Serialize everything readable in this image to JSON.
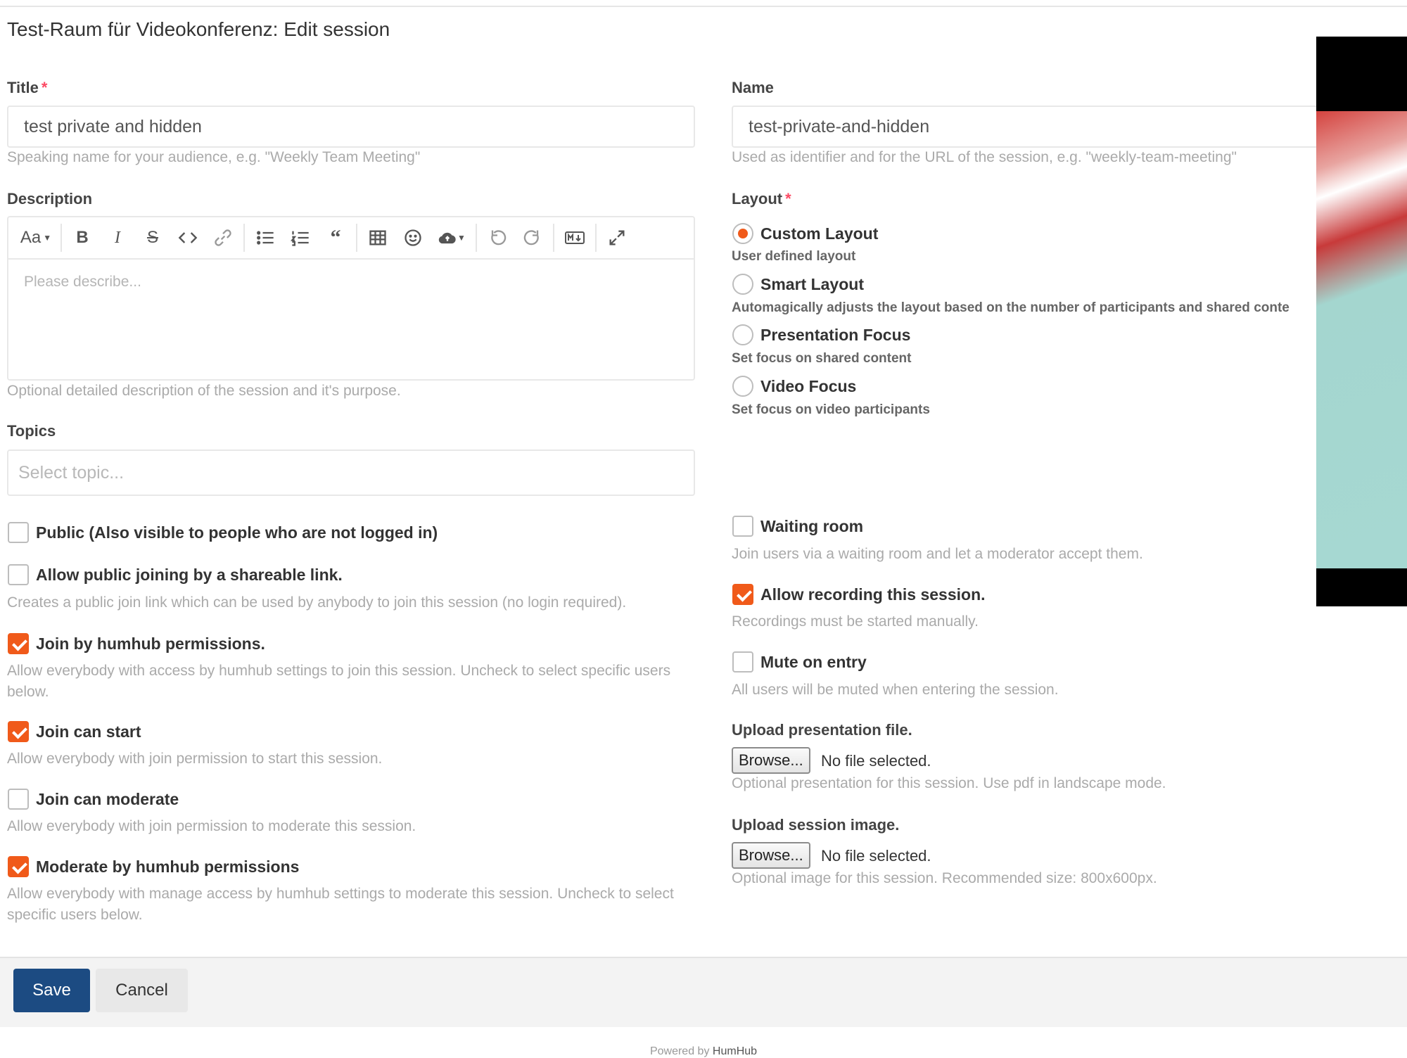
{
  "page": {
    "title": "Test-Raum für Videokonferenz: Edit session"
  },
  "title_field": {
    "label": "Title",
    "required_mark": "*",
    "value": "test private and hidden",
    "help": "Speaking name for your audience, e.g. \"Weekly Team Meeting\""
  },
  "name_field": {
    "label": "Name",
    "value": "test-private-and-hidden",
    "help": "Used as identifier and for the URL of the session, e.g. \"weekly-team-meeting\""
  },
  "description": {
    "label": "Description",
    "placeholder": "Please describe...",
    "help": "Optional detailed description of the session and it's purpose.",
    "toolbar": {
      "font_label": "Aa",
      "icons": [
        "format-size-icon",
        "bold-icon",
        "italic-icon",
        "strikethrough-icon",
        "code-icon",
        "link-icon",
        "bullet-list-icon",
        "ordered-list-icon",
        "blockquote-icon",
        "table-icon",
        "emoji-icon",
        "upload-cloud-icon",
        "undo-icon",
        "redo-icon",
        "markdown-icon",
        "fullscreen-icon"
      ]
    }
  },
  "topics": {
    "label": "Topics",
    "placeholder": "Select topic..."
  },
  "layout": {
    "label": "Layout",
    "required_mark": "*",
    "options": [
      {
        "label": "Custom Layout",
        "sub": "User defined layout",
        "checked": true
      },
      {
        "label": "Smart Layout",
        "sub": "Automagically adjusts the layout based on the number of participants and shared conte",
        "checked": false
      },
      {
        "label": "Presentation Focus",
        "sub": "Set focus on shared content",
        "checked": false
      },
      {
        "label": "Video Focus",
        "sub": "Set focus on video participants",
        "checked": false
      }
    ]
  },
  "left_checks": [
    {
      "label": "Public (Also visible to people who are not logged in)",
      "checked": false,
      "help": ""
    },
    {
      "label": "Allow public joining by a shareable link.",
      "checked": false,
      "help": "Creates a public join link which can be used by anybody to join this session (no login required)."
    },
    {
      "label": "Join by humhub permissions.",
      "checked": true,
      "help": "Allow everybody with access by humhub settings to join this session. Uncheck to select specific users below."
    },
    {
      "label": "Join can start",
      "checked": true,
      "help": "Allow everybody with join permission to start this session."
    },
    {
      "label": "Join can moderate",
      "checked": false,
      "help": "Allow everybody with join permission to moderate this session."
    },
    {
      "label": "Moderate by humhub permissions",
      "checked": true,
      "help": "Allow everybody with manage access by humhub settings to moderate this session. Uncheck to select specific users below."
    }
  ],
  "right_checks": [
    {
      "label": "Waiting room",
      "checked": false,
      "help": "Join users via a waiting room and let a moderator accept them."
    },
    {
      "label": "Allow recording this session.",
      "checked": true,
      "help": "Recordings must be started manually."
    },
    {
      "label": "Mute on entry",
      "checked": false,
      "help": "All users will be muted when entering the session."
    }
  ],
  "uploads": [
    {
      "label": "Upload presentation file.",
      "button": "Browse...",
      "status": "No file selected.",
      "help": "Optional presentation for this session. Use pdf in landscape mode."
    },
    {
      "label": "Upload session image.",
      "button": "Browse...",
      "status": "No file selected.",
      "help": "Optional image for this session. Recommended size: 800x600px."
    }
  ],
  "footer": {
    "save": "Save",
    "cancel": "Cancel",
    "powered_prefix": "Powered by",
    "powered_link": "HumHub"
  },
  "colors": {
    "accent": "#f05a1a",
    "primary": "#1c4b82",
    "required": "#fc4a64"
  }
}
